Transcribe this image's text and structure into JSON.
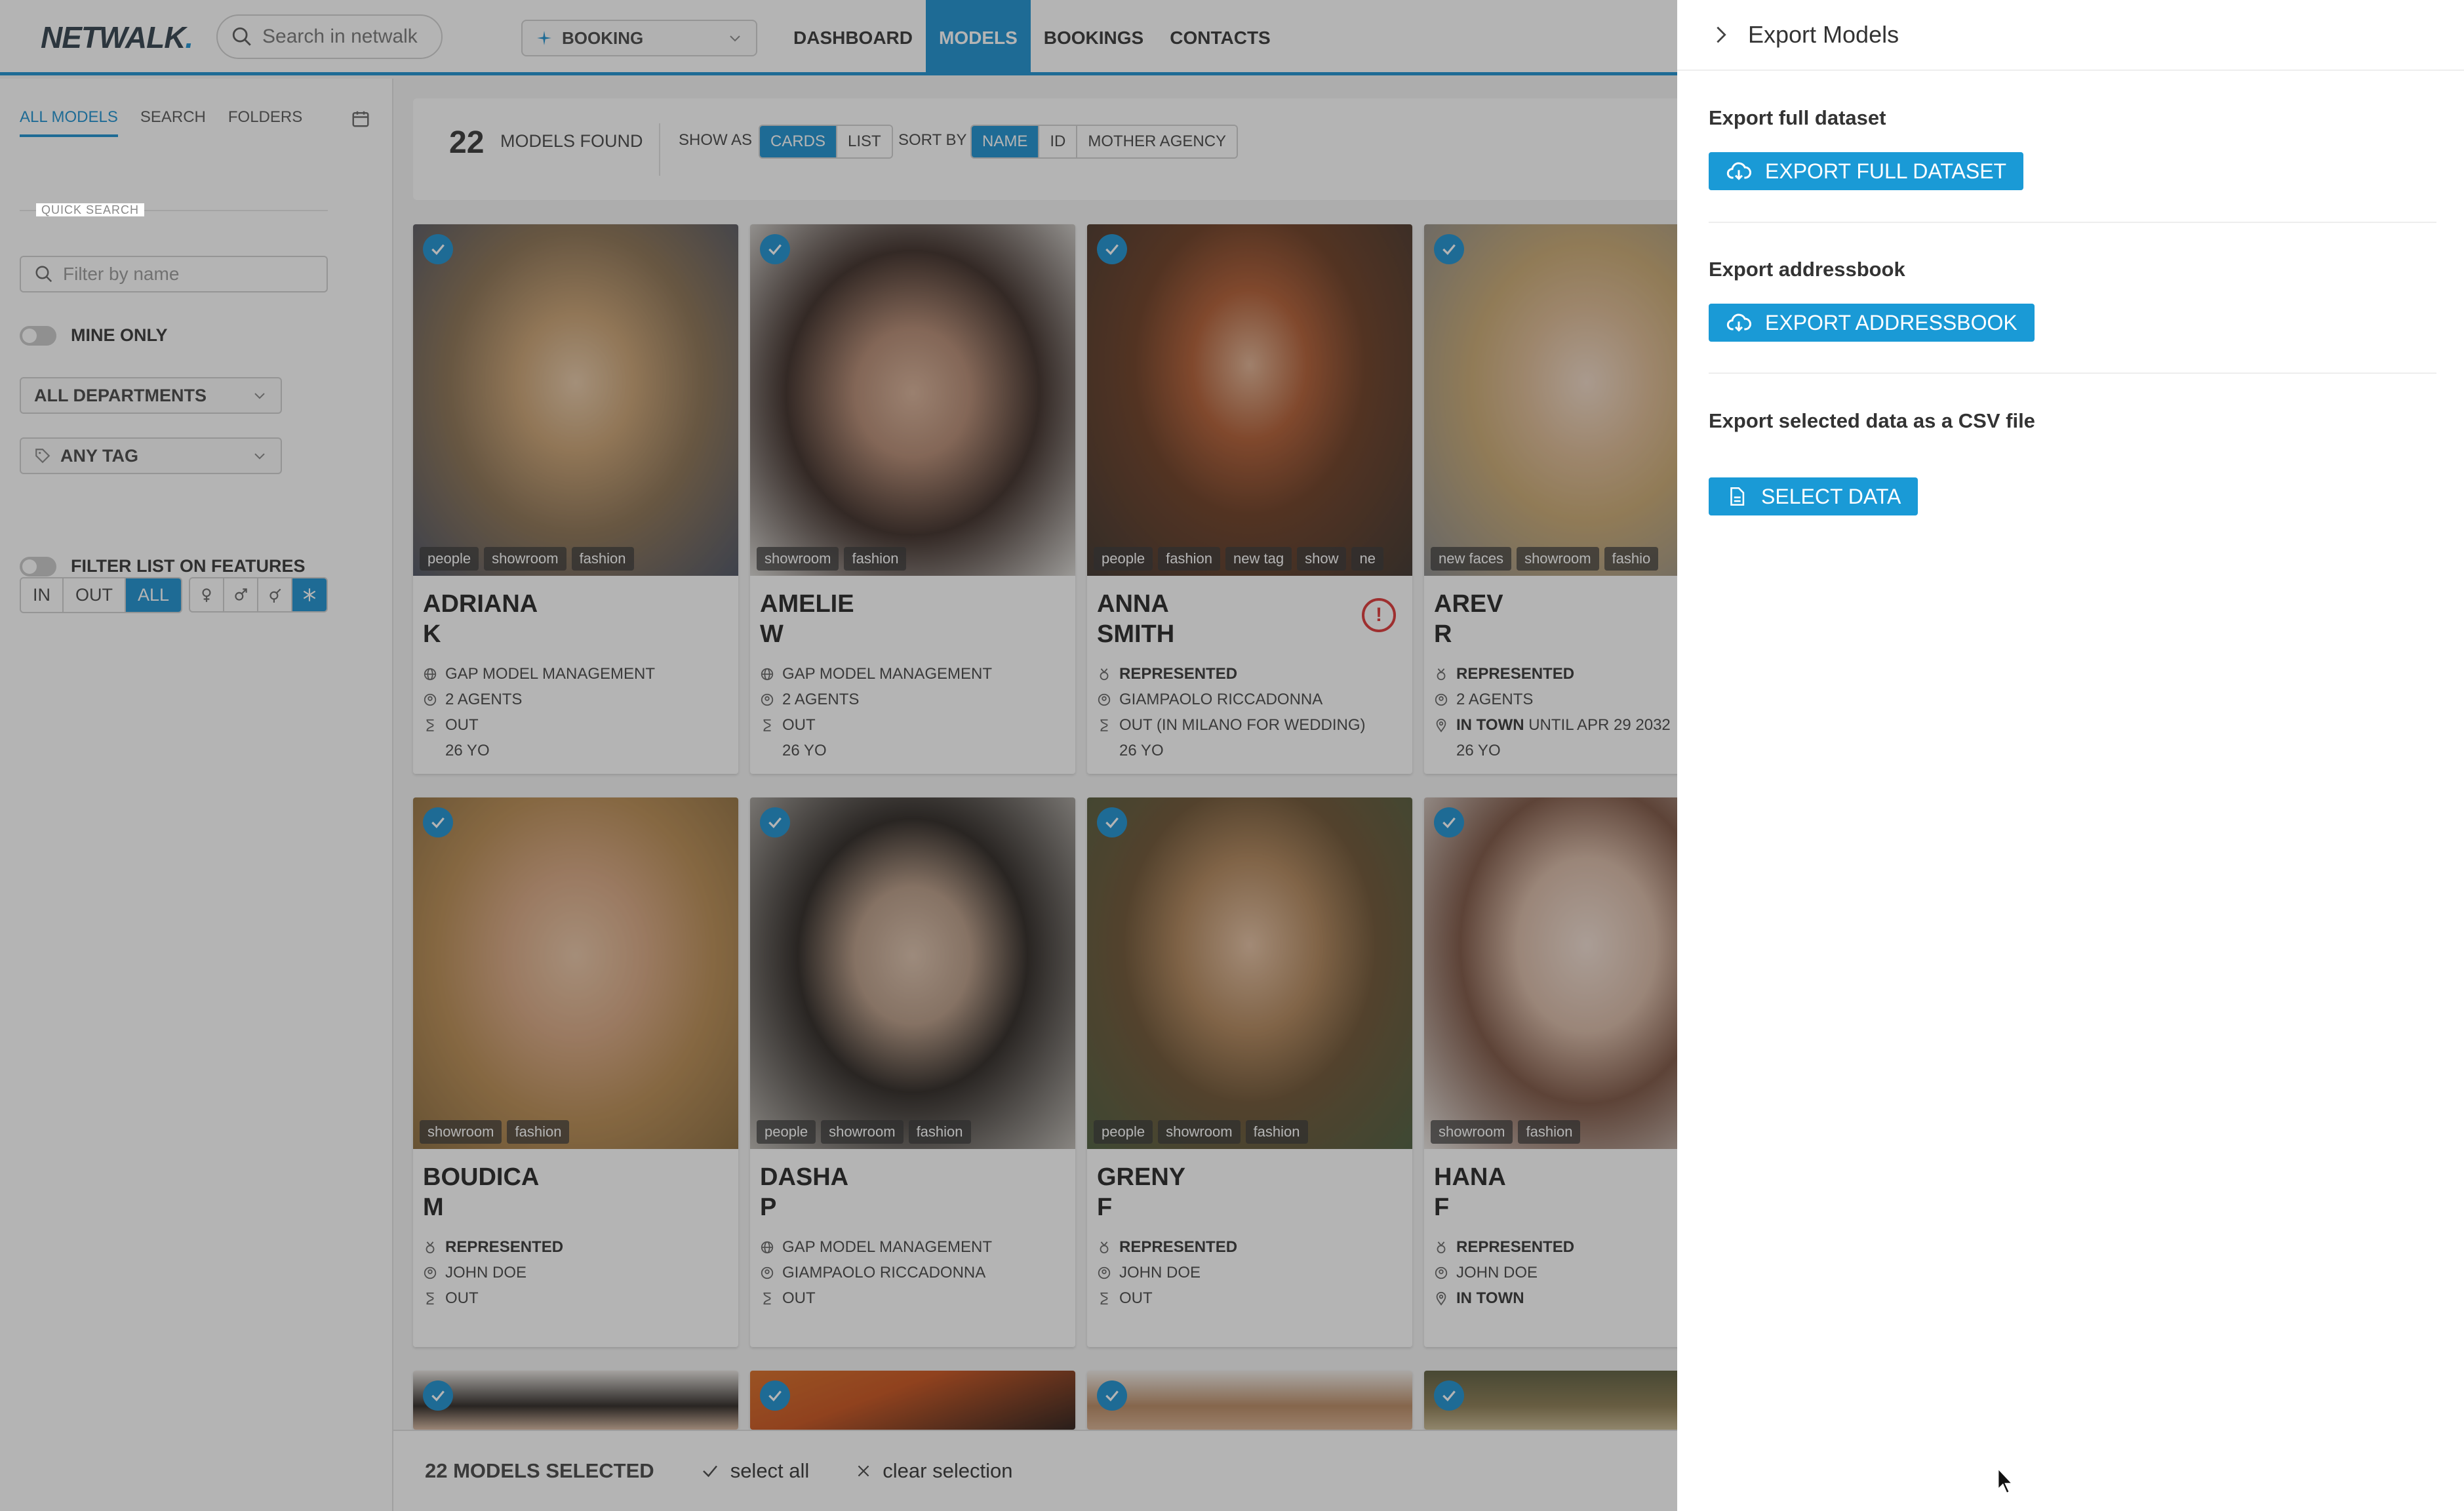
{
  "topbar": {
    "logo": "NETWALK",
    "search_placeholder": "Search in netwalk",
    "role": "BOOKING",
    "nav": [
      "DASHBOARD",
      "MODELS",
      "BOOKINGS",
      "CONTACTS"
    ]
  },
  "sidebar": {
    "tabs": [
      "ALL MODELS",
      "SEARCH",
      "FOLDERS"
    ],
    "quick_search_label": "QUICK SEARCH",
    "filter_placeholder": "Filter by name",
    "mine_only": "MINE ONLY",
    "departments": "ALL DEPARTMENTS",
    "tag": "ANY TAG",
    "inout": [
      "IN",
      "OUT",
      "ALL"
    ],
    "filter_features": "FILTER LIST ON FEATURES"
  },
  "results": {
    "count": "22",
    "found_label": "MODELS FOUND",
    "show_as_label": "SHOW AS",
    "show_as": [
      "CARDS",
      "LIST"
    ],
    "sort_by_label": "SORT BY",
    "sort_by": [
      "NAME",
      "ID",
      "MOTHER AGENCY"
    ]
  },
  "cards": [
    {
      "first": "ADRIANA",
      "last": "K",
      "tags": [
        "people",
        "showroom",
        "fashion"
      ],
      "line1": "GAP MODEL MANAGEMENT",
      "line2": "2 AGENTS",
      "line3": "OUT",
      "line4": "26 YO"
    },
    {
      "first": "AMELIE",
      "last": "W",
      "tags": [
        "showroom",
        "fashion"
      ],
      "line1": "GAP MODEL MANAGEMENT",
      "line2": "2 AGENTS",
      "line3": "OUT",
      "line4": "26 YO"
    },
    {
      "first": "ANNA",
      "last": "SMITH",
      "tags": [
        "people",
        "fashion",
        "new tag",
        "show",
        "ne"
      ],
      "line1": "REPRESENTED",
      "line2": "GIAMPAOLO RICCADONNA",
      "line3": "OUT (IN MILANO FOR WEDDING)",
      "line4": "26 YO"
    },
    {
      "first": "AREV",
      "last": "R",
      "tags": [
        "new faces",
        "showroom",
        "fashio"
      ],
      "line1": "REPRESENTED",
      "line2": "2 AGENTS",
      "line3a": "IN TOWN",
      "line3b": "UNTIL APR 29 2032",
      "line4": "26 YO"
    },
    {
      "first": "BOUDICA",
      "last": "M",
      "tags": [
        "showroom",
        "fashion"
      ],
      "line1": "REPRESENTED",
      "line2": "JOHN DOE",
      "line3": "OUT"
    },
    {
      "first": "DASHA",
      "last": "P",
      "tags": [
        "people",
        "showroom",
        "fashion"
      ],
      "line1": "GAP MODEL MANAGEMENT",
      "line2": "GIAMPAOLO RICCADONNA",
      "line3": "OUT"
    },
    {
      "first": "GRENY",
      "last": "F",
      "tags": [
        "people",
        "showroom",
        "fashion"
      ],
      "line1": "REPRESENTED",
      "line2": "JOHN DOE",
      "line3": "OUT"
    },
    {
      "first": "HANA",
      "last": "F",
      "tags": [
        "showroom",
        "fashion"
      ],
      "line1": "REPRESENTED",
      "line2": "JOHN DOE",
      "line3": "IN TOWN"
    }
  ],
  "selection": {
    "count_label": "22 MODELS SELECTED",
    "select_all": "select all",
    "clear": "clear selection"
  },
  "panel": {
    "title": "Export Models",
    "full_title": "Export full dataset",
    "full_btn": "EXPORT FULL DATASET",
    "address_title": "Export addressbook",
    "address_btn": "EXPORT ADDRESSBOOK",
    "csv_title": "Export selected data as a CSV file",
    "csv_btn": "SELECT DATA"
  },
  "colors": {
    "accent": "#1a8fcf",
    "button": "#1a9ad6",
    "alert": "#dd3333"
  }
}
